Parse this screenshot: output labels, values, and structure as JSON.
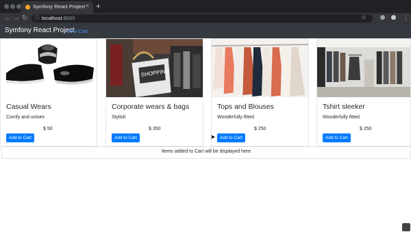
{
  "browser": {
    "tab_title": "Symfony React Project",
    "tab_close": "×",
    "new_tab": "+",
    "url_host": "localhost",
    "url_port": ":8000",
    "back_icon": "←",
    "forward_icon": "→",
    "reload_icon": "↻",
    "info_icon": "ⓘ",
    "star_icon": "☆",
    "menu_icon": "⋮"
  },
  "navbar": {
    "brand": "Symfony React Project",
    "link": "View Cart"
  },
  "products": [
    {
      "title": "Casual Wears",
      "description": "Comfy and unisex",
      "price": "$ 50",
      "button": "Add to Cart"
    },
    {
      "title": "Corporate wears & bags",
      "description": "Stylish",
      "price": "$ 350",
      "button": "Add to Cart"
    },
    {
      "title": "Tops and Blouses",
      "description": "Wonderfully fitted",
      "price": "$ 250",
      "button": "Add to Cart"
    },
    {
      "title": "Tshirt sleeker",
      "description": "Wonderfully fitted",
      "price": "$ 250",
      "button": "Add to Cart"
    }
  ],
  "cart": {
    "message": "Items added to Cart will be displayed here"
  },
  "colors": {
    "navbar_bg": "#343a40",
    "link": "#4f8ff7",
    "button_primary": "#007bff"
  }
}
